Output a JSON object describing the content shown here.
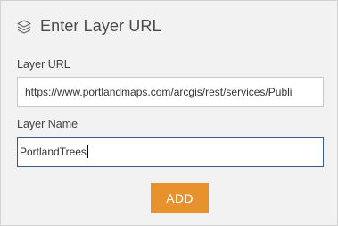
{
  "panel": {
    "title": "Enter Layer URL",
    "title_icon": "layers-icon"
  },
  "form": {
    "url_label": "Layer URL",
    "url_value": "https://www.portlandmaps.com/arcgis/rest/services/Publi",
    "name_label": "Layer Name",
    "name_value": "PortlandTrees",
    "add_label": "ADD"
  },
  "colors": {
    "accent": "#e8922e",
    "focus_border": "#3b5b85",
    "panel_bg": "#f2f2f2"
  }
}
